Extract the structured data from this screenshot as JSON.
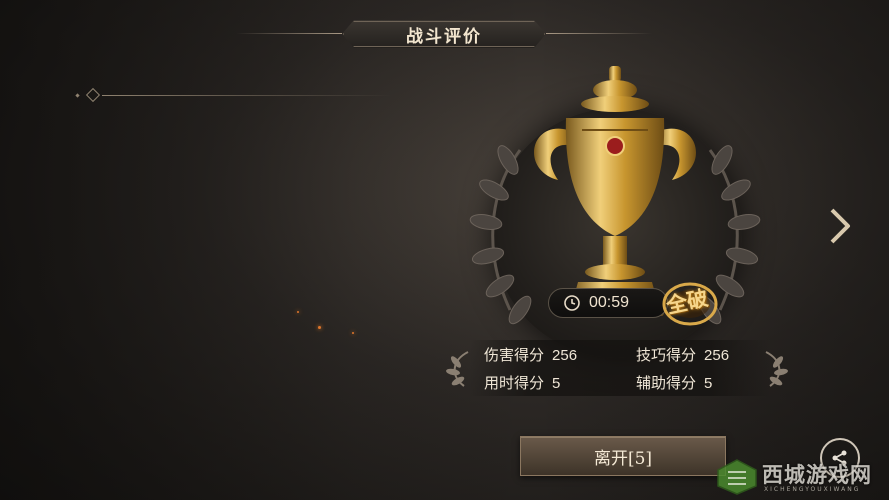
{
  "header": {
    "title": "战斗评价"
  },
  "result": {
    "time": "00:59",
    "badge": "全破"
  },
  "scores": [
    {
      "label": "伤害得分",
      "value": "256"
    },
    {
      "label": "技巧得分",
      "value": "256"
    },
    {
      "label": "用时得分",
      "value": "5"
    },
    {
      "label": "辅助得分",
      "value": "5"
    }
  ],
  "actions": {
    "leave_label": "离开[5]"
  },
  "watermark": {
    "text": "西城游戏网",
    "sub": "XICHENGYOUXIWANG"
  },
  "icons": {
    "next": "chevron-right-icon",
    "share": "share-icon",
    "clock": "clock-icon"
  },
  "colors": {
    "gold": "#d4a64a",
    "panel": "#24211e",
    "text": "#efe6d6"
  }
}
